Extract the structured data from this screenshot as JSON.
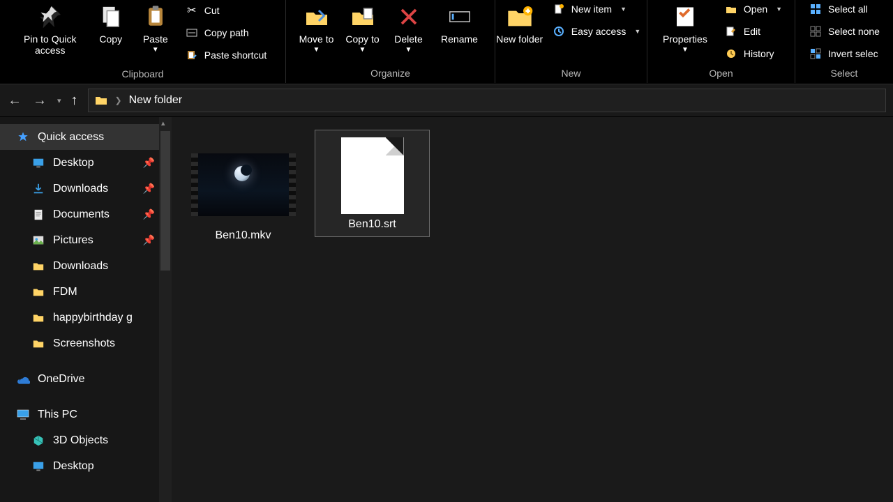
{
  "ribbon": {
    "groups": {
      "clipboard": {
        "label": "Clipboard",
        "pin": "Pin to Quick access",
        "copy": "Copy",
        "paste": "Paste",
        "cut": "Cut",
        "copy_path": "Copy path",
        "paste_shortcut": "Paste shortcut"
      },
      "organize": {
        "label": "Organize",
        "move_to": "Move to",
        "copy_to": "Copy to",
        "delete": "Delete",
        "rename": "Rename"
      },
      "new": {
        "label": "New",
        "new_folder": "New folder",
        "new_item": "New item",
        "easy_access": "Easy access"
      },
      "open": {
        "label": "Open",
        "properties": "Properties",
        "open": "Open",
        "edit": "Edit",
        "history": "History"
      },
      "select": {
        "label": "Select",
        "select_all": "Select all",
        "select_none": "Select none",
        "invert": "Invert selec"
      }
    }
  },
  "breadcrumb": {
    "current": "New folder"
  },
  "sidebar": {
    "quick_access": "Quick access",
    "items": [
      {
        "label": "Desktop",
        "pinned": true,
        "icon": "desktop"
      },
      {
        "label": "Downloads",
        "pinned": true,
        "icon": "download"
      },
      {
        "label": "Documents",
        "pinned": true,
        "icon": "document"
      },
      {
        "label": "Pictures",
        "pinned": true,
        "icon": "pictures"
      },
      {
        "label": "Downloads",
        "pinned": false,
        "icon": "folder"
      },
      {
        "label": "FDM",
        "pinned": false,
        "icon": "folder"
      },
      {
        "label": "happybirthday g",
        "pinned": false,
        "icon": "folder"
      },
      {
        "label": "Screenshots",
        "pinned": false,
        "icon": "folder"
      }
    ],
    "onedrive": "OneDrive",
    "this_pc": "This PC",
    "pc_items": [
      {
        "label": "3D Objects",
        "icon": "3d"
      },
      {
        "label": "Desktop",
        "icon": "desktop"
      }
    ]
  },
  "files": [
    {
      "name": "Ben10.mkv",
      "type": "video",
      "selected": false
    },
    {
      "name": "Ben10.srt",
      "type": "blank",
      "selected": true
    }
  ]
}
